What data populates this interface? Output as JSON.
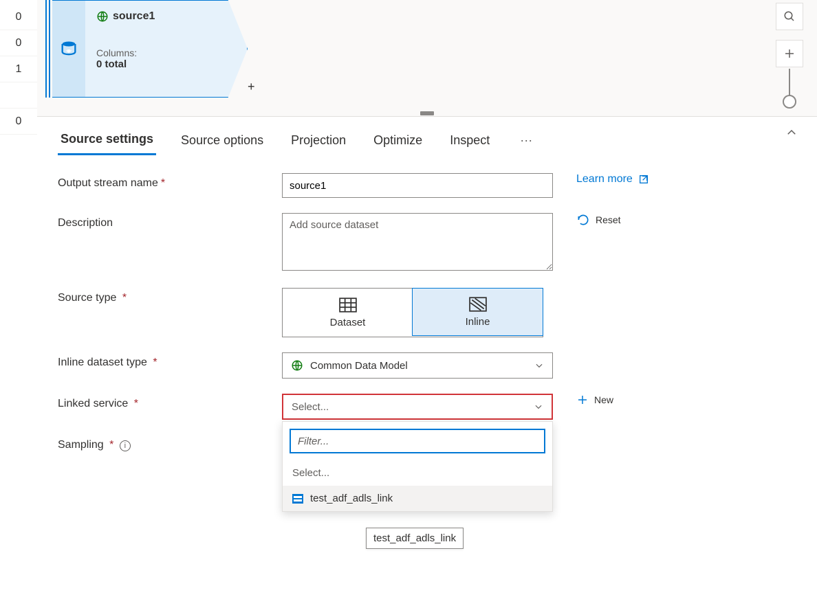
{
  "rail": {
    "items": [
      "0",
      "0",
      "1",
      "",
      "0"
    ]
  },
  "canvas": {
    "node": {
      "title": "source1",
      "columns_label": "Columns:",
      "columns_count": "0 total"
    }
  },
  "tabs": {
    "items": [
      {
        "label": "Source settings"
      },
      {
        "label": "Source options"
      },
      {
        "label": "Projection"
      },
      {
        "label": "Optimize"
      },
      {
        "label": "Inspect"
      }
    ],
    "active": 0
  },
  "form": {
    "output_stream": {
      "label": "Output stream name",
      "value": "source1"
    },
    "description": {
      "label": "Description",
      "placeholder": "Add source dataset",
      "value": ""
    },
    "source_type": {
      "label": "Source type",
      "options": [
        "Dataset",
        "Inline"
      ],
      "selected": 1
    },
    "inline_type": {
      "label": "Inline dataset type",
      "value": "Common Data Model"
    },
    "linked_service": {
      "label": "Linked service",
      "placeholder": "Select...",
      "new_label": "New",
      "filter_placeholder": "Filter...",
      "options": [
        {
          "label": "Select...",
          "is_placeholder": true
        },
        {
          "label": "test_adf_adls_link",
          "icon": "storage-icon"
        }
      ],
      "hovered": 1
    },
    "sampling": {
      "label": "Sampling"
    },
    "learn_more": "Learn more",
    "reset": "Reset"
  },
  "tooltip": {
    "text": "test_adf_adls_link"
  }
}
